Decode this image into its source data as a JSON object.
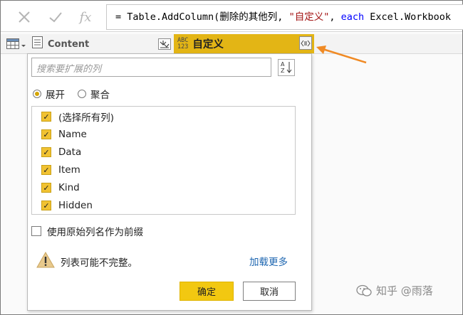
{
  "formula_bar": {
    "cancel_icon": "x-icon",
    "commit_icon": "check-icon",
    "fx_label": "fx",
    "formula": {
      "prefix": "= Table.AddColumn(删除的其他列, ",
      "string": "\"自定义\"",
      "sep": ", ",
      "keyword": "each",
      "rest": " Excel.Workbook"
    }
  },
  "grid": {
    "table_icon": "table-icon",
    "columns": [
      {
        "type_icon": "text-type-icon",
        "label": "Content",
        "expand_icon": "expand-down-icon"
      },
      {
        "type_label_top": "ABC",
        "type_label_bottom": "123",
        "label": "自定义",
        "expand_icon": "expand-columns-icon"
      }
    ]
  },
  "popup": {
    "search_placeholder": "搜索要扩展的列",
    "sort_icon": "sort-az-icon",
    "mode": {
      "options": [
        "展开",
        "聚合"
      ],
      "selected": "展开"
    },
    "columns": [
      {
        "label": "(选择所有列)",
        "checked": true
      },
      {
        "label": "Name",
        "checked": true
      },
      {
        "label": "Data",
        "checked": true
      },
      {
        "label": "Item",
        "checked": true
      },
      {
        "label": "Kind",
        "checked": true
      },
      {
        "label": "Hidden",
        "checked": true
      }
    ],
    "prefix_label": "使用原始列名作为前缀",
    "prefix_checked": false,
    "warning_text": "列表可能不完整。",
    "load_more": "加载更多",
    "ok_label": "确定",
    "cancel_label": "取消"
  },
  "watermark": {
    "text": "知乎 @雨落",
    "icon": "wechat-icon"
  },
  "colors": {
    "accent": "#f2c811",
    "header_highlight": "#e3b515",
    "arrow": "#f08a24",
    "link": "#1f67b1"
  }
}
